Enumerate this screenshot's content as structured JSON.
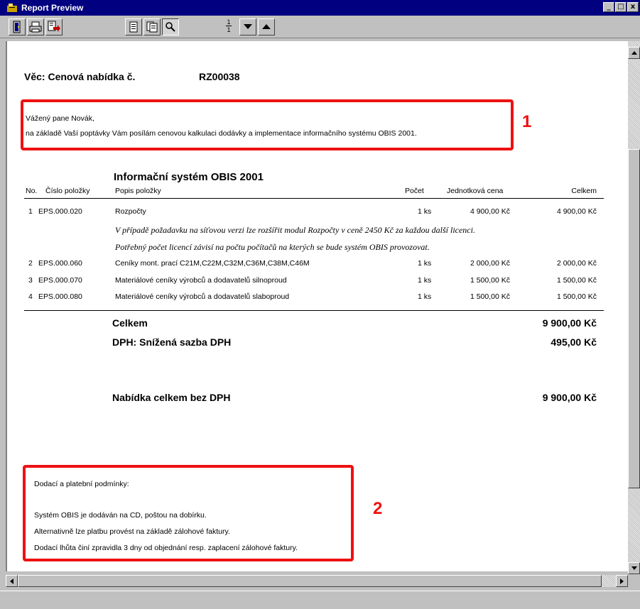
{
  "window": {
    "title": "Report Preview",
    "buttons": [
      "_",
      "□",
      "x"
    ]
  },
  "toolbar": {
    "buttons": [
      "exit-icon",
      "print-icon",
      "export-icon",
      "one-page-icon",
      "two-page-icon",
      "zoom-icon",
      "page-down-icon",
      "page-up-icon"
    ],
    "page_current": "1",
    "page_total": "1"
  },
  "report": {
    "subject_label": "Věc: Cenová nabídka č.",
    "subject_number": "RZ00038",
    "greeting": "Vážený pane Novák,",
    "intro": "na základě Vaší poptávky Vám posílám cenovou kalkulaci dodávky a implementace informačního systému OBIS 2001.",
    "section_title": "Informační systém OBIS 2001",
    "columns": [
      "No.",
      "Číslo položky",
      "Popis položky",
      "Počet",
      "Jednotková cena",
      "Celkem"
    ],
    "items": [
      {
        "no": "1",
        "code": "EPS.000.020",
        "description": "Rozpočty",
        "qty": "1 ks",
        "unit_price": "4 900,00 Kč",
        "total": "4 900,00 Kč"
      },
      {
        "no": "2",
        "code": "EPS.000.060",
        "description": "Ceníky mont. prací  C21M,C22M,C32M,C36M,C38M,C46M",
        "qty": "1 ks",
        "unit_price": "2 000,00 Kč",
        "total": "2 000,00 Kč"
      },
      {
        "no": "3",
        "code": "EPS.000.070",
        "description": "Materiálové ceníky výrobců a dodavatelů  silnoproud",
        "qty": "1 ks",
        "unit_price": "1 500,00 Kč",
        "total": "1 500,00 Kč"
      },
      {
        "no": "4",
        "code": "EPS.000.080",
        "description": "Materiálové ceníky výrobců a dodavatelů  slaboproud",
        "qty": "1 ks",
        "unit_price": "1 500,00 Kč",
        "total": "1 500,00 Kč"
      }
    ],
    "notes": [
      "V případě požadavku na síťovou verzi lze rozšířit modul Rozpočty v ceně 2450 Kč za každou další licenci.",
      "Potřebný počet licencí závisí na počtu počítačů na kterých se bude systém OBIS provozovat."
    ],
    "total_label": "Celkem",
    "total_value": "9 900,00 Kč",
    "vat_label": "DPH:  Snížená sazba DPH",
    "vat_value": "495,00 Kč",
    "grand_label": "Nabídka celkem bez DPH",
    "grand_value": "9 900,00 Kč",
    "terms_title": "Dodací a platební podmínky:",
    "terms_lines": [
      "Systém OBIS je dodáván na CD, poštou na dobírku.",
      "Alternativně lze platbu provést na základě zálohové faktury.",
      "Dodací lhůta činí zpravidla 3 dny od objednání resp. zaplacení zálohové faktury."
    ]
  },
  "annotations": {
    "marker_1": "1",
    "marker_2": "2",
    "color": "#ee1111"
  }
}
